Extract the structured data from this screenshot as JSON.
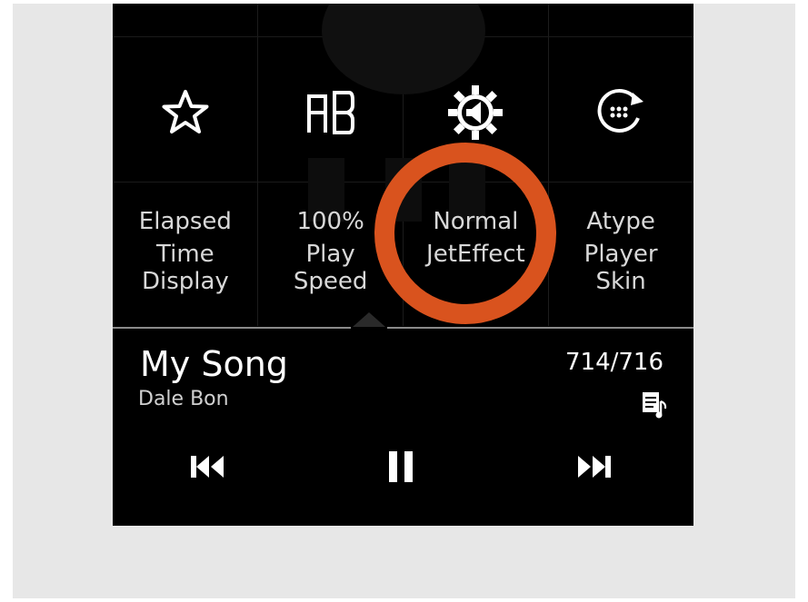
{
  "quick_settings": {
    "icons": [
      {
        "name": "favorite-star-icon"
      },
      {
        "name": "ab-repeat-icon"
      },
      {
        "name": "jeteffect-icon"
      },
      {
        "name": "player-skin-icon"
      }
    ],
    "labels": [
      {
        "line1": "Elapsed",
        "line2": "Time",
        "line3": "Display"
      },
      {
        "line1": "100%",
        "line2": "Play",
        "line3": "Speed"
      },
      {
        "line1": "Normal",
        "line2": "JetEffect",
        "line3": ""
      },
      {
        "line1": "Atype",
        "line2": "Player",
        "line3": "Skin"
      }
    ]
  },
  "now_playing": {
    "title": "My Song",
    "artist": "Dale Bon",
    "track_position": "714/716"
  },
  "controls": {
    "previous": "previous-track-icon",
    "pause": "pause-icon",
    "next": "next-track-icon"
  },
  "colors": {
    "highlight_ring": "#d9531e",
    "device_bg": "#000000",
    "frame_bg": "#e7e7e7"
  }
}
